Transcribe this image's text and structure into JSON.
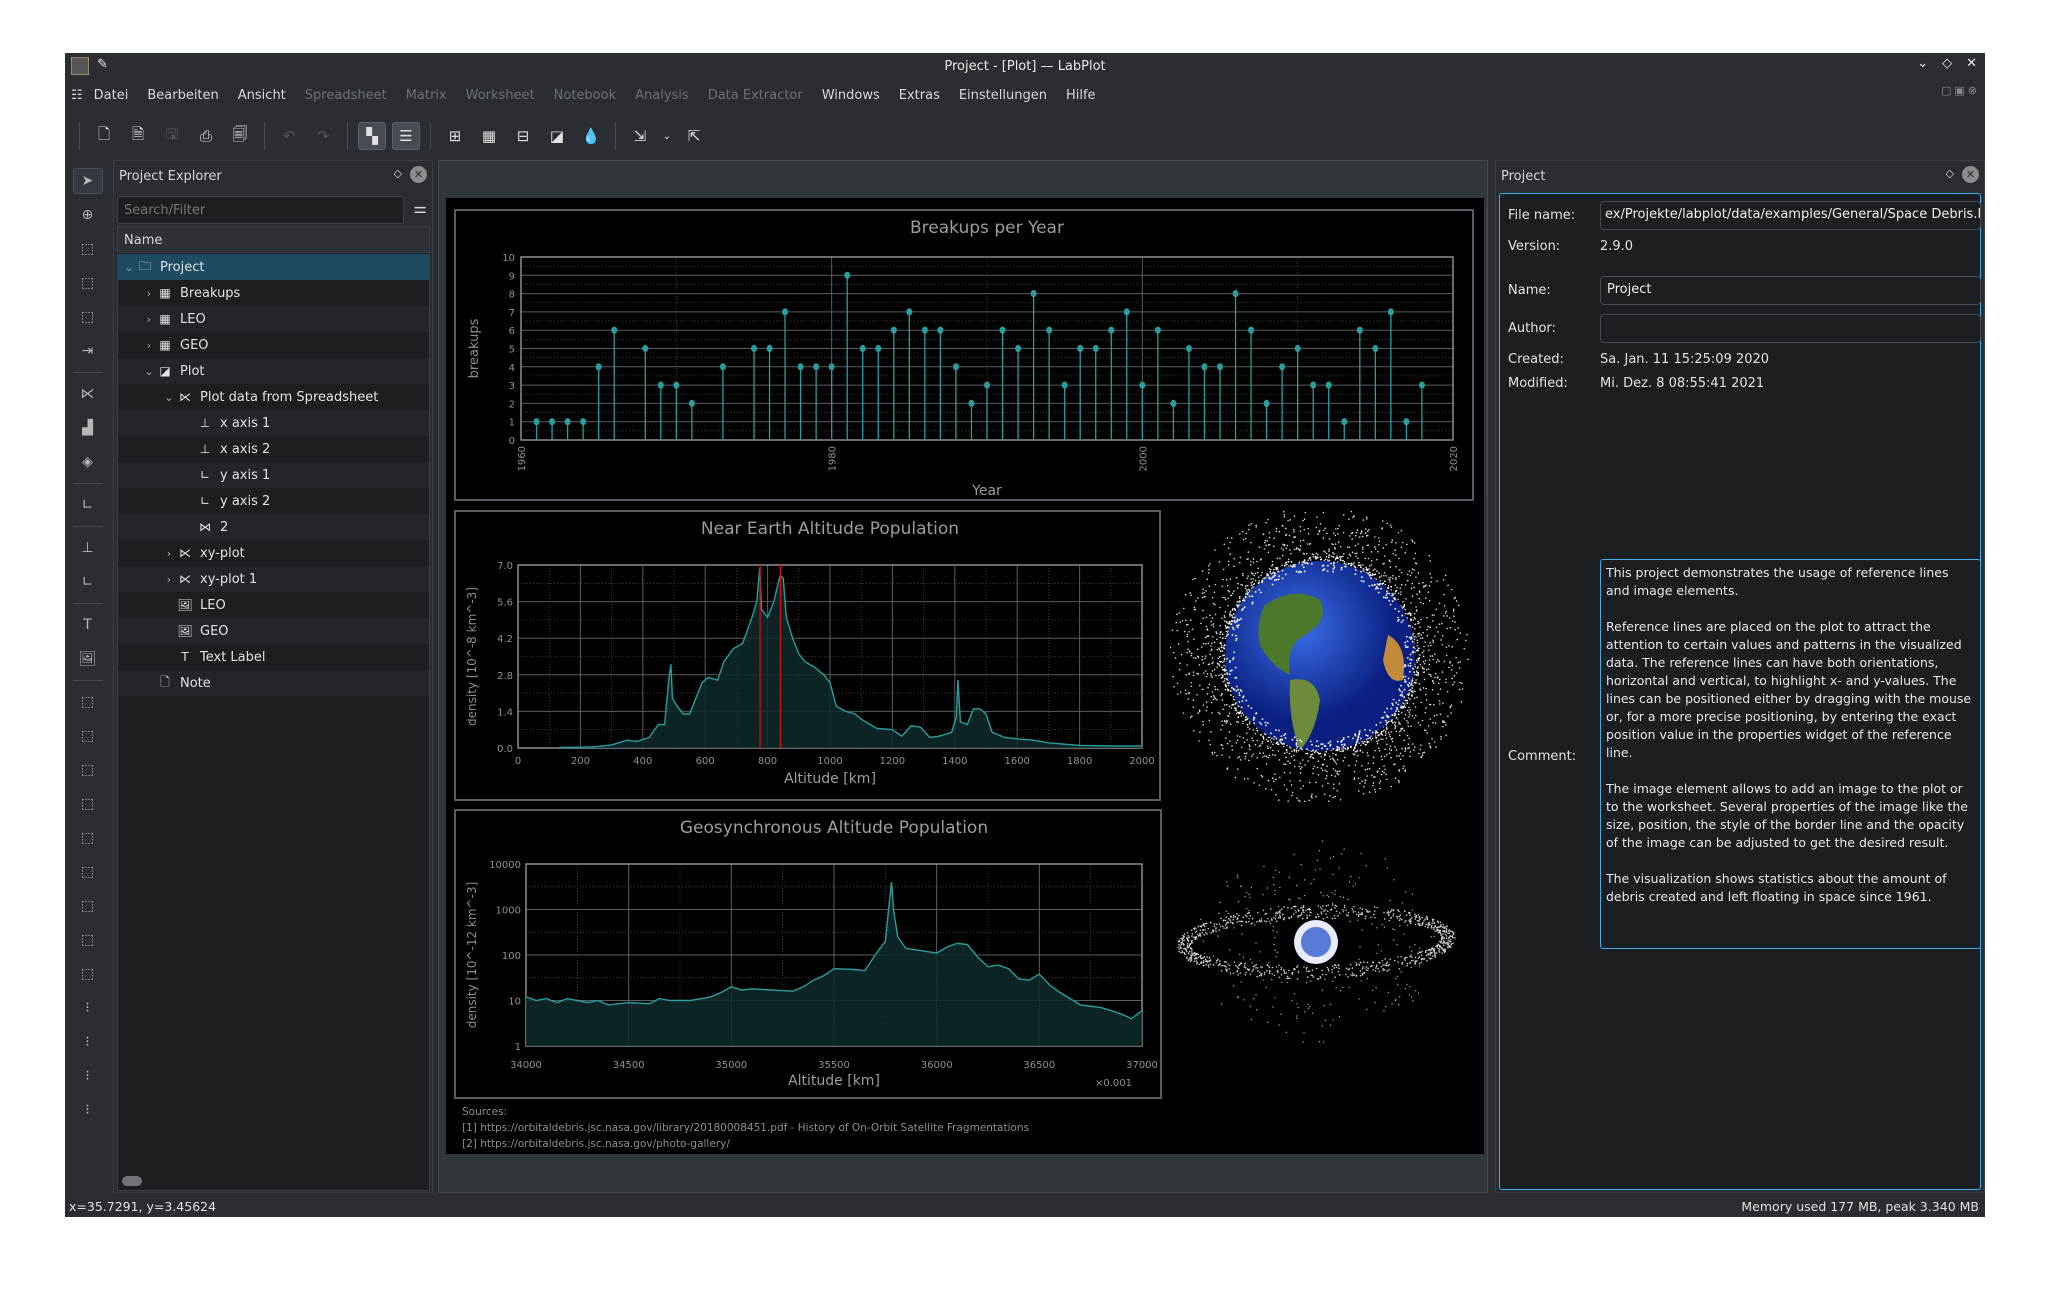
{
  "window": {
    "title": "Project - [Plot] — LabPlot"
  },
  "menu": [
    {
      "label": "Datei",
      "enabled": true
    },
    {
      "label": "Bearbeiten",
      "enabled": true
    },
    {
      "label": "Ansicht",
      "enabled": true
    },
    {
      "label": "Spreadsheet",
      "enabled": false
    },
    {
      "label": "Matrix",
      "enabled": false
    },
    {
      "label": "Worksheet",
      "enabled": false
    },
    {
      "label": "Notebook",
      "enabled": false
    },
    {
      "label": "Analysis",
      "enabled": false
    },
    {
      "label": "Data Extractor",
      "enabled": false
    },
    {
      "label": "Windows",
      "enabled": true
    },
    {
      "label": "Extras",
      "enabled": true
    },
    {
      "label": "Einstellungen",
      "enabled": true
    },
    {
      "label": "Hilfe",
      "enabled": true
    }
  ],
  "explorer": {
    "title": "Project Explorer",
    "search_placeholder": "Search/Filter",
    "column": "Name",
    "items": [
      {
        "label": "Project",
        "level": 0,
        "icon": "folder-icon",
        "expand": "open"
      },
      {
        "label": "Breakups",
        "level": 1,
        "icon": "spreadsheet-icon",
        "expand": "closed"
      },
      {
        "label": "LEO",
        "level": 1,
        "icon": "spreadsheet-icon",
        "expand": "closed"
      },
      {
        "label": "GEO",
        "level": 1,
        "icon": "spreadsheet-icon",
        "expand": "closed"
      },
      {
        "label": "Plot",
        "level": 1,
        "icon": "worksheet-icon",
        "expand": "open"
      },
      {
        "label": "Plot data from Spreadsheet",
        "level": 2,
        "icon": "plot-area-icon",
        "expand": "open"
      },
      {
        "label": "x axis 1",
        "level": 3,
        "icon": "x-axis-icon",
        "expand": "none"
      },
      {
        "label": "x axis 2",
        "level": 3,
        "icon": "x-axis-icon",
        "expand": "none"
      },
      {
        "label": "y axis 1",
        "level": 3,
        "icon": "y-axis-icon",
        "expand": "none"
      },
      {
        "label": "y axis 2",
        "level": 3,
        "icon": "y-axis-icon",
        "expand": "none"
      },
      {
        "label": "2",
        "level": 3,
        "icon": "xy-curve-icon",
        "expand": "none"
      },
      {
        "label": "xy-plot",
        "level": 2,
        "icon": "plot-area-icon",
        "expand": "closed"
      },
      {
        "label": "xy-plot 1",
        "level": 2,
        "icon": "plot-area-icon",
        "expand": "closed"
      },
      {
        "label": "LEO",
        "level": 2,
        "icon": "image-icon",
        "expand": "none"
      },
      {
        "label": "GEO",
        "level": 2,
        "icon": "image-icon",
        "expand": "none"
      },
      {
        "label": "Text Label",
        "level": 2,
        "icon": "text-label-icon",
        "expand": "none"
      },
      {
        "label": "Note",
        "level": 1,
        "icon": "note-icon",
        "expand": "none"
      }
    ]
  },
  "properties": {
    "title": "Project",
    "file_name_label": "File name:",
    "file_name": "ex/Projekte/labplot/data/examples/General/Space Debris.lml",
    "version_label": "Version:",
    "version": "2.9.0",
    "name_label": "Name:",
    "name": "Project",
    "author_label": "Author:",
    "author": "",
    "created_label": "Created:",
    "created": "Sa. Jan. 11 15:25:09 2020",
    "modified_label": "Modified:",
    "modified": "Mi. Dez. 8 08:55:41 2021",
    "comment_label": "Comment:",
    "comment": "This project demonstrates the usage of reference lines and image elements.\n\nReference lines are placed on the plot to attract the attention to certain values and patterns in the visualized data. The reference lines can have both orientations, horizontal and vertical, to highlight x- and y-values. The lines can be positioned either by dragging with the mouse or, for a more precise positioning, by entering the exact position value in the properties widget of the reference line.\n\nThe image element allows to add an image to the plot or to the worksheet. Several properties of the image like the size, position, the style of the border line and the opacity of the image can be adjusted to get the desired result.\n\nThe visualization shows statistics about the amount of debris created and left floating in space since 1961."
  },
  "worksheet": {
    "sources": [
      "Sources:",
      "[1] https://orbitaldebris.jsc.nasa.gov/library/20180008451.pdf  - History of On-Orbit Satellite Fragmentations",
      "[2] https://orbitaldebris.jsc.nasa.gov/photo-gallery/"
    ],
    "images": [
      {
        "name": "LEO",
        "icon": "earth-leo-image"
      },
      {
        "name": "GEO",
        "icon": "earth-geo-image"
      }
    ]
  },
  "status": {
    "cursor": "x=35.7291, y=3.45624",
    "memory": "Memory used 177 MB, peak 3.340 MB"
  },
  "colors": {
    "curve": "#2a9d9f",
    "reference_line": "#d01010",
    "selection": "#1e4a62",
    "focus": "#3daee9"
  },
  "chart_data": [
    {
      "type": "lollipop",
      "title": "Breakups per Year",
      "xlabel": "Year",
      "ylabel": "breakups",
      "xlim": [
        1960,
        2020
      ],
      "ylim": [
        0,
        10
      ],
      "xticks": [
        "1960",
        "1980",
        "2000",
        "2020"
      ],
      "yticks": [
        "0",
        "1",
        "2",
        "3",
        "4",
        "5",
        "6",
        "7",
        "8",
        "9",
        "10"
      ],
      "grid": true,
      "x": [
        1961,
        1962,
        1963,
        1964,
        1965,
        1966,
        1968,
        1969,
        1970,
        1971,
        1973,
        1975,
        1976,
        1977,
        1978,
        1979,
        1980,
        1981,
        1982,
        1983,
        1984,
        1985,
        1986,
        1987,
        1988,
        1989,
        1990,
        1991,
        1992,
        1993,
        1994,
        1995,
        1996,
        1997,
        1998,
        1999,
        2000,
        2001,
        2002,
        2003,
        2004,
        2005,
        2006,
        2007,
        2008,
        2009,
        2010,
        2011,
        2012,
        2013,
        2014,
        2015,
        2016,
        2017,
        2018
      ],
      "y": [
        1,
        1,
        1,
        1,
        4,
        6,
        5,
        3,
        3,
        2,
        4,
        5,
        5,
        7,
        4,
        4,
        4,
        9,
        5,
        5,
        6,
        7,
        6,
        6,
        4,
        2,
        3,
        6,
        5,
        8,
        6,
        3,
        5,
        5,
        6,
        7,
        3,
        6,
        2,
        5,
        4,
        4,
        8,
        6,
        2,
        4,
        5,
        3,
        3,
        1,
        6,
        5,
        7,
        1,
        3
      ]
    },
    {
      "type": "area",
      "title": "Near Earth Altitude Population",
      "xlabel": "Altitude [km]",
      "ylabel": "density [10^-8 km^-3]",
      "xlim": [
        0,
        2000
      ],
      "ylim": [
        0,
        7
      ],
      "xticks": [
        "0",
        "200",
        "400",
        "600",
        "800",
        "1000",
        "1200",
        "1400",
        "1600",
        "1800",
        "2000"
      ],
      "yticks": [
        "0.0",
        "1.4",
        "2.8",
        "4.2",
        "5.6",
        "7.0"
      ],
      "grid": true,
      "reference_lines_x": [
        776,
        841
      ],
      "x": [
        130,
        200,
        250,
        300,
        350,
        380,
        420,
        450,
        470,
        485,
        490,
        495,
        510,
        530,
        550,
        570,
        590,
        610,
        640,
        660,
        690,
        720,
        750,
        765,
        775,
        780,
        800,
        820,
        840,
        850,
        860,
        880,
        900,
        920,
        950,
        980,
        1000,
        1020,
        1050,
        1080,
        1100,
        1150,
        1200,
        1230,
        1260,
        1290,
        1320,
        1350,
        1390,
        1405,
        1410,
        1418,
        1440,
        1460,
        1480,
        1500,
        1520,
        1560,
        1600,
        1650,
        1700,
        1800,
        1900,
        2000
      ],
      "y": [
        0.02,
        0.03,
        0.05,
        0.12,
        0.3,
        0.25,
        0.4,
        0.9,
        0.9,
        2.8,
        3.2,
        1.9,
        1.6,
        1.3,
        1.3,
        1.9,
        2.5,
        2.7,
        2.6,
        3.3,
        3.8,
        4.0,
        5.0,
        5.6,
        6.9,
        5.3,
        5.0,
        5.6,
        6.6,
        6.5,
        5.0,
        4.2,
        3.6,
        3.3,
        3.1,
        2.8,
        2.5,
        1.6,
        1.4,
        1.3,
        1.1,
        0.75,
        0.7,
        0.45,
        0.85,
        0.8,
        0.4,
        0.45,
        0.6,
        1.2,
        2.6,
        1.0,
        0.9,
        1.5,
        1.5,
        1.3,
        0.6,
        0.4,
        0.35,
        0.3,
        0.2,
        0.1,
        0.08,
        0.08
      ]
    },
    {
      "type": "area",
      "title": "Geosynchronous Altitude Population",
      "xlabel": "Altitude [km]",
      "ylabel": "density [10^-12 km^-3]",
      "xscale_note": "×0.001",
      "yscale": "log",
      "xlim": [
        34000,
        37000
      ],
      "ylim": [
        1,
        10000
      ],
      "xticks": [
        "34000",
        "34500",
        "35000",
        "35500",
        "36000",
        "36500",
        "37000"
      ],
      "yticks": [
        "1",
        "10",
        "100",
        "1000",
        "10000"
      ],
      "grid": true,
      "x": [
        34000,
        34050,
        34100,
        34150,
        34200,
        34300,
        34350,
        34400,
        34500,
        34600,
        34650,
        34700,
        34800,
        34900,
        34950,
        35000,
        35050,
        35100,
        35200,
        35300,
        35350,
        35400,
        35450,
        35500,
        35600,
        35650,
        35700,
        35750,
        35770,
        35780,
        35790,
        35810,
        35850,
        35900,
        36000,
        36050,
        36100,
        36150,
        36200,
        36250,
        36300,
        36350,
        36400,
        36450,
        36500,
        36550,
        36600,
        36650,
        36700,
        36800,
        36850,
        36900,
        36950,
        37000
      ],
      "y": [
        12,
        10,
        11,
        9,
        11,
        9,
        10,
        8,
        9,
        8.5,
        11,
        10,
        10,
        12,
        15,
        20,
        17,
        18,
        17,
        16,
        20,
        28,
        35,
        50,
        48,
        45,
        100,
        200,
        1500,
        4000,
        1000,
        250,
        140,
        130,
        110,
        150,
        180,
        170,
        90,
        55,
        60,
        50,
        30,
        28,
        38,
        22,
        15,
        11,
        8,
        7,
        6,
        5,
        4,
        6
      ]
    }
  ]
}
